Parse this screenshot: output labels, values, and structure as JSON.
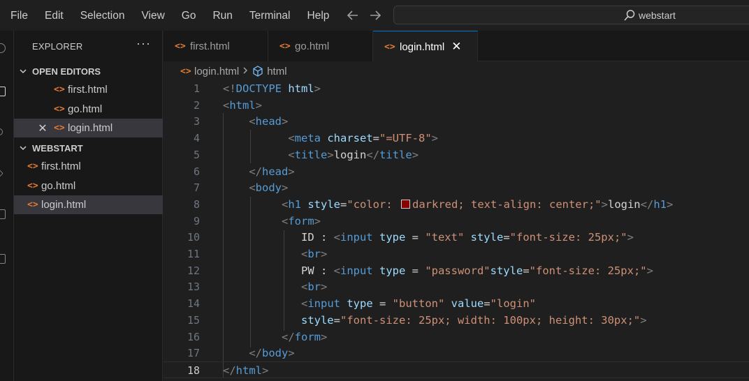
{
  "menu": [
    "File",
    "Edit",
    "Selection",
    "View",
    "Go",
    "Run",
    "Terminal",
    "Help"
  ],
  "search": {
    "text": "webstart"
  },
  "explorer": {
    "title": "EXPLORER",
    "more": "···",
    "open_editors": {
      "label": "OPEN EDITORS",
      "items": [
        {
          "label": "first.html"
        },
        {
          "label": "go.html"
        },
        {
          "label": "login.html",
          "close": "✕"
        }
      ]
    },
    "workspace": {
      "label": "WEBSTART",
      "items": [
        {
          "label": "first.html"
        },
        {
          "label": "go.html"
        },
        {
          "label": "login.html"
        }
      ]
    }
  },
  "tabs": [
    {
      "label": "first.html"
    },
    {
      "label": "go.html"
    },
    {
      "label": "login.html",
      "close": "✕"
    }
  ],
  "breadcrumb": {
    "file": "login.html",
    "symbol": "html"
  },
  "editor": {
    "line_numbers": [
      "1",
      "2",
      "3",
      "4",
      "5",
      "6",
      "7",
      "8",
      "9",
      "10",
      "11",
      "12",
      "13",
      "14",
      "15",
      "16",
      "17",
      "18"
    ],
    "current_line": 18,
    "lines": [
      [
        [
          "t",
          "<!"
        ],
        [
          "n",
          "DOCTYPE "
        ],
        [
          "a",
          "html"
        ],
        [
          "t",
          ">"
        ]
      ],
      [
        [
          "t",
          "<"
        ],
        [
          "n",
          "html"
        ],
        [
          "t",
          ">"
        ]
      ],
      [
        [
          "w",
          "    "
        ],
        [
          "t",
          "<"
        ],
        [
          "n",
          "head"
        ],
        [
          "t",
          ">"
        ]
      ],
      [
        [
          "w",
          "          "
        ],
        [
          "t",
          "<"
        ],
        [
          "n",
          "meta "
        ],
        [
          "a",
          "charset"
        ],
        [
          "w",
          "="
        ],
        [
          "s",
          "\"=UTF-8\""
        ],
        [
          "t",
          ">"
        ]
      ],
      [
        [
          "w",
          "          "
        ],
        [
          "t",
          "<"
        ],
        [
          "n",
          "title"
        ],
        [
          "t",
          ">"
        ],
        [
          "w",
          "login"
        ],
        [
          "t",
          "</"
        ],
        [
          "n",
          "title"
        ],
        [
          "t",
          ">"
        ]
      ],
      [
        [
          "w",
          "    "
        ],
        [
          "t",
          "</"
        ],
        [
          "n",
          "head"
        ],
        [
          "t",
          ">"
        ]
      ],
      [
        [
          "w",
          "    "
        ],
        [
          "t",
          "<"
        ],
        [
          "n",
          "body"
        ],
        [
          "t",
          ">"
        ]
      ],
      [
        [
          "w",
          "         "
        ],
        [
          "t",
          "<"
        ],
        [
          "n",
          "h1 "
        ],
        [
          "a",
          "style"
        ],
        [
          "w",
          "="
        ],
        [
          "s",
          "\"color: "
        ],
        [
          "swatch",
          ""
        ],
        [
          "s",
          "darkred; text-align: center;\""
        ],
        [
          "t",
          ">"
        ],
        [
          "w",
          "login"
        ],
        [
          "t",
          "</"
        ],
        [
          "n",
          "h1"
        ],
        [
          "t",
          ">"
        ]
      ],
      [
        [
          "w",
          "         "
        ],
        [
          "t",
          "<"
        ],
        [
          "n",
          "form"
        ],
        [
          "t",
          ">"
        ]
      ],
      [
        [
          "w",
          "            ID : "
        ],
        [
          "t",
          "<"
        ],
        [
          "n",
          "input "
        ],
        [
          "a",
          "type"
        ],
        [
          "w",
          " = "
        ],
        [
          "s",
          "\"text\" "
        ],
        [
          "a",
          "style"
        ],
        [
          "w",
          "="
        ],
        [
          "s",
          "\"font-size: 25px;\""
        ],
        [
          "t",
          ">"
        ]
      ],
      [
        [
          "w",
          "            "
        ],
        [
          "t",
          "<"
        ],
        [
          "n",
          "br"
        ],
        [
          "t",
          ">"
        ]
      ],
      [
        [
          "w",
          "            PW : "
        ],
        [
          "t",
          "<"
        ],
        [
          "n",
          "input "
        ],
        [
          "a",
          "type"
        ],
        [
          "w",
          " = "
        ],
        [
          "s",
          "\"password\""
        ],
        [
          "a",
          "style"
        ],
        [
          "w",
          "="
        ],
        [
          "s",
          "\"font-size: 25px;\""
        ],
        [
          "t",
          ">"
        ]
      ],
      [
        [
          "w",
          "            "
        ],
        [
          "t",
          "<"
        ],
        [
          "n",
          "br"
        ],
        [
          "t",
          ">"
        ]
      ],
      [
        [
          "w",
          "            "
        ],
        [
          "t",
          "<"
        ],
        [
          "n",
          "input "
        ],
        [
          "a",
          "type"
        ],
        [
          "w",
          " = "
        ],
        [
          "s",
          "\"button\" "
        ],
        [
          "a",
          "value"
        ],
        [
          "w",
          "="
        ],
        [
          "s",
          "\"login\""
        ]
      ],
      [
        [
          "w",
          "            "
        ],
        [
          "a",
          "style"
        ],
        [
          "w",
          "="
        ],
        [
          "s",
          "\"font-size: 25px; width: 100px; height: 30px;\""
        ],
        [
          "t",
          ">"
        ]
      ],
      [
        [
          "w",
          "         "
        ],
        [
          "t",
          "</"
        ],
        [
          "n",
          "form"
        ],
        [
          "t",
          ">"
        ]
      ],
      [
        [
          "w",
          "    "
        ],
        [
          "t",
          "</"
        ],
        [
          "n",
          "body"
        ],
        [
          "t",
          ">"
        ]
      ],
      [
        [
          "t",
          "</"
        ],
        [
          "n",
          "html"
        ],
        [
          "t",
          ">"
        ]
      ]
    ]
  },
  "colors": {
    "background": "#1f1f1f",
    "sidebar": "#181818",
    "accent": "#0078d4",
    "file_icon": "#e37933",
    "tag": "#569cd6",
    "attribute": "#9cdcfe",
    "string": "#ce9178",
    "bracket": "#808080",
    "darkred_swatch": "#8b0000"
  },
  "icons": [
    "arrow-left-icon",
    "arrow-right-icon",
    "search-icon",
    "html-file-icon",
    "close-icon",
    "chevron-down-icon",
    "cube-symbol-icon",
    "more-icon"
  ]
}
